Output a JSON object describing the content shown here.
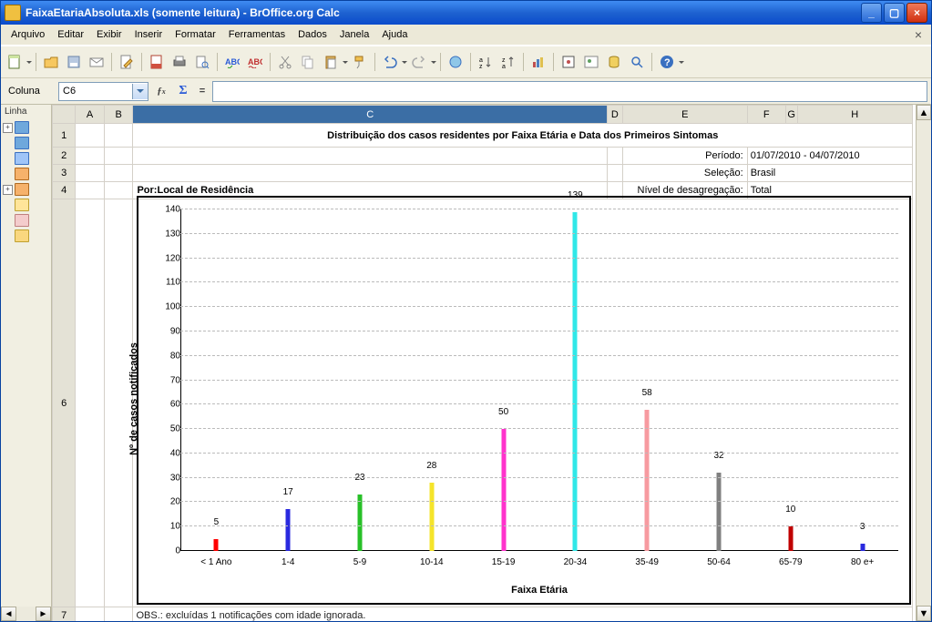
{
  "window": {
    "title": "FaixaEtariaAbsoluta.xls (somente leitura) - BrOffice.org Calc"
  },
  "menu": {
    "arquivo": "Arquivo",
    "editar": "Editar",
    "exibir": "Exibir",
    "inserir": "Inserir",
    "formatar": "Formatar",
    "ferramentas": "Ferramentas",
    "dados": "Dados",
    "janela": "Janela",
    "ajuda": "Ajuda"
  },
  "left": {
    "coluna": "Coluna",
    "linha": "Linha"
  },
  "formula": {
    "cell": "C6"
  },
  "cols": {
    "A": "A",
    "B": "B",
    "C": "C",
    "D": "D",
    "E": "E",
    "F": "F",
    "G": "G",
    "H": "H"
  },
  "rows": {
    "r1": "1",
    "r2": "2",
    "r3": "3",
    "r4": "4",
    "r6": "6",
    "r7": "7"
  },
  "cells": {
    "c1_title": "Distribuição dos casos residentes por Faixa Etária e Data dos Primeiros Sintomas",
    "periodo_lbl": "Período:",
    "periodo_val": "01/07/2010 - 04/07/2010",
    "selecao_lbl": "Seleção:",
    "selecao_val": "Brasil",
    "por_lbl": "Por:Local de Residência",
    "nivel_lbl": "Nível de desagregação:",
    "nivel_val": "Total",
    "obs": "OBS.: excluídas 1 notificações com idade ignorada."
  },
  "chart_data": {
    "type": "bar",
    "title": "",
    "xlabel": "Faixa Etária",
    "ylabel": "Nº de casos notificados",
    "ylim": [
      0,
      140
    ],
    "ystep": 10,
    "categories": [
      "< 1 Ano",
      "1-4",
      "5-9",
      "10-14",
      "15-19",
      "20-34",
      "35-49",
      "50-64",
      "65-79",
      "80 e+"
    ],
    "values": [
      5,
      17,
      23,
      28,
      50,
      139,
      58,
      32,
      10,
      3
    ],
    "colors": [
      "#ff0000",
      "#2a2adf",
      "#28c028",
      "#f5e42a",
      "#ff33cc",
      "#30e8e8",
      "#f79aa0",
      "#808080",
      "#c00000",
      "#2a2adf"
    ]
  }
}
